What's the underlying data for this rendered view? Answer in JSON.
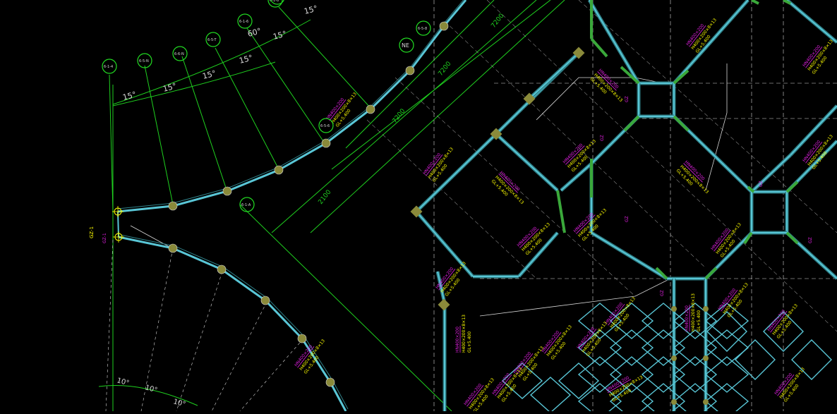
{
  "colors": {
    "background": "#000000",
    "grid_green": "#1fd11f",
    "beam_cyan": "#59c6d6",
    "beam_outline": "#2f7f86",
    "label_magenta": "#e020e0",
    "label_yellow": "#ffff00",
    "axis_white": "#d8d8d8",
    "column_fill": "#8a8a3a",
    "bubble_green": "#22dd22",
    "thick_green": "#3aa83a"
  },
  "grid_bubbles": {
    "arc_row": [
      "6-1-4",
      "6-5-N",
      "6-6-N",
      "6-5-T",
      "6-1-6",
      "6-1-8",
      "6-5-8",
      "6-5-6"
    ],
    "inner": [
      "6-1-A",
      "6-1-3"
    ],
    "boxed_label": "NE"
  },
  "angle_labels": {
    "upper": [
      "15°",
      "15°",
      "15°",
      "15°",
      "15°",
      "60°",
      "15°"
    ],
    "lower": [
      "10°",
      "10°",
      "10°"
    ]
  },
  "dimension_labels": [
    "7200",
    "2100",
    "7200",
    "7200"
  ],
  "member_labels": {
    "magenta": "HN400×200",
    "yellow_1": "H400×200×8×13",
    "yellow_2": "GL+5.400"
  },
  "side_tag": "GZ-1"
}
